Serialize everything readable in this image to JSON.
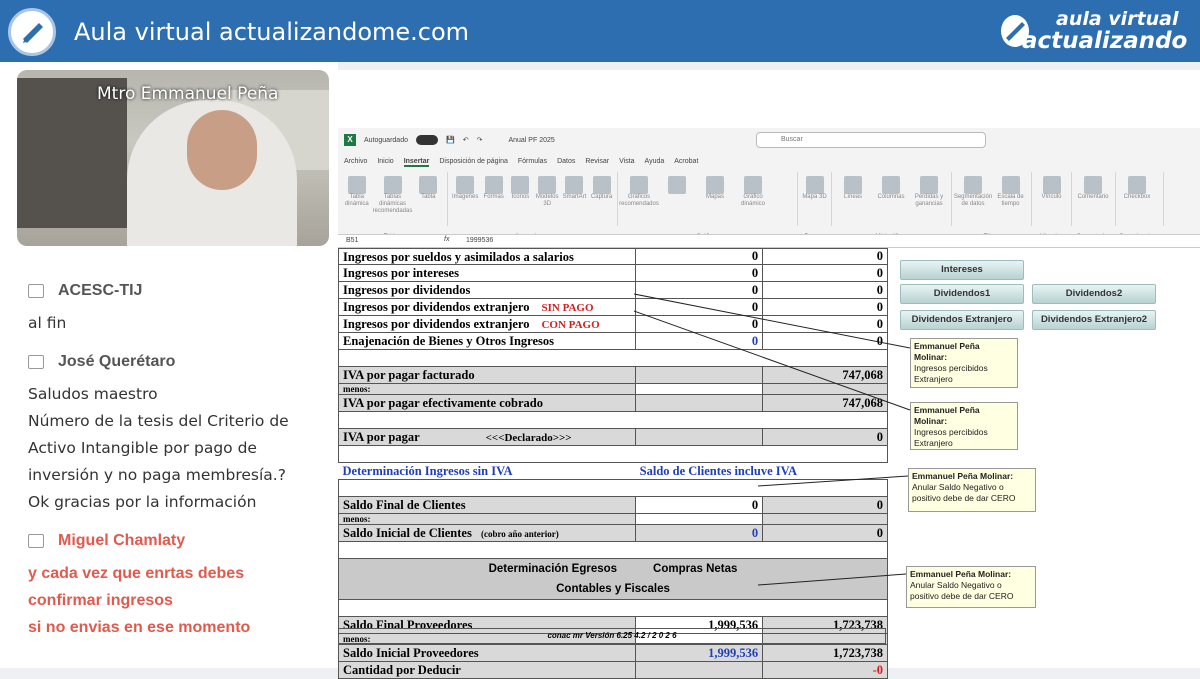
{
  "header": {
    "title": "Aula virtual actualizandome.com",
    "brand_line1": "aula virtual",
    "brand_line2": "actualizando"
  },
  "camera": {
    "presenter_name": "Mtro Emmanuel Peña"
  },
  "chat": [
    {
      "user": "ACESC-TIJ",
      "lines": [
        "al fin"
      ],
      "highlight": false
    },
    {
      "user": "José Querétaro",
      "lines": [
        "Saludos maestro",
        "Número de la tesis del Criterio de",
        "Activo Intangible por pago de",
        "inversión y no paga membresía.?",
        "Ok gracias por la información"
      ],
      "highlight": false
    },
    {
      "user": "Miguel Chamlaty",
      "lines": [
        "y cada vez que enrtas debes",
        "confirmar ingresos",
        "si no envias en ese momento"
      ],
      "highlight": true
    }
  ],
  "excel": {
    "autosave_label": "Autoguardado",
    "file_name": "Anual PF 2025",
    "search_placeholder": "Buscar",
    "menus": [
      "Archivo",
      "Inicio",
      "Insertar",
      "Disposición de página",
      "Fórmulas",
      "Datos",
      "Revisar",
      "Vista",
      "Ayuda",
      "Acrobat"
    ],
    "active_menu": "Insertar",
    "groups": [
      {
        "caption": "Tablas",
        "buttons": [
          "Tabla dinámica",
          "Tablas dinámicas recomendadas",
          "Tabla"
        ]
      },
      {
        "caption": "Ilustraciones",
        "buttons": [
          "Imágenes",
          "Formas",
          "Iconos",
          "Modelos 3D",
          "SmartArt",
          "Captura"
        ]
      },
      {
        "caption": "Gráficos",
        "buttons": [
          "Gráficos recomendados",
          "",
          "Mapas",
          "Gráfico dinámico"
        ]
      },
      {
        "caption": "Paseos",
        "buttons": [
          "Mapa 3D"
        ]
      },
      {
        "caption": "Minigráficos",
        "buttons": [
          "Líneas",
          "Columnas",
          "Pérdidas y ganancias"
        ]
      },
      {
        "caption": "Filtros",
        "buttons": [
          "Segmentación de datos",
          "Escala de tiempo"
        ]
      },
      {
        "caption": "Vínculos",
        "buttons": [
          "Vínculo"
        ]
      },
      {
        "caption": "Comentarios",
        "buttons": [
          "Comentario"
        ]
      },
      {
        "caption": "Controles de ...",
        "buttons": [
          "Checkbox"
        ]
      }
    ],
    "cell_ref": "B51",
    "formula_value": "1999536"
  },
  "sheet": {
    "rows_top": [
      {
        "label": "Ingresos por sueldos y asimilados a salarios",
        "tag": "",
        "v1": "0",
        "v2": "0",
        "v1_blue": false
      },
      {
        "label": "Ingresos por intereses",
        "tag": "",
        "v1": "0",
        "v2": "0",
        "v1_blue": false
      },
      {
        "label": "Ingresos por dividendos",
        "tag": "",
        "v1": "0",
        "v2": "0",
        "v1_blue": false
      },
      {
        "label": "Ingresos por dividendos extranjero",
        "tag": "SIN PAGO",
        "v1": "0",
        "v2": "0",
        "v1_blue": false
      },
      {
        "label": "Ingresos por dividendos extranjero",
        "tag": "CON PAGO",
        "v1": "0",
        "v2": "0",
        "v1_blue": false
      },
      {
        "label": "Enajenación de Bienes y Otros Ingresos",
        "tag": "",
        "v1": "0",
        "v2": "0",
        "v1_blue": true
      }
    ],
    "iva_facturado": {
      "label": "IVA por pagar facturado",
      "v2": "747,068"
    },
    "menos": "menos:",
    "iva_cobrado": {
      "label": "IVA por pagar efectivamente cobrado",
      "v2": "747,068"
    },
    "iva_pagar": {
      "label": "IVA por pagar",
      "mid": "<<<Declarado>>>",
      "v2": "0"
    },
    "det_ingresos": {
      "left": "Determinación Ingresos sin IVA",
      "right": "Saldo de Clientes incluve IVA"
    },
    "saldo_final_clientes": {
      "label": "Saldo Final de Clientes",
      "v1": "0",
      "v2": "0"
    },
    "saldo_inicial_clientes": {
      "label": "Saldo Inicial de Clientes",
      "note": "(cobro año anterior)",
      "v1": "0",
      "v2": "0"
    },
    "egresos_head": {
      "a": "Determinación Egresos",
      "b": "Compras Netas",
      "c": "Contables y Fiscales"
    },
    "saldo_final_prov": {
      "label": "Saldo Final Proveedores",
      "v1": "1,999,536",
      "v2": "1,723,738"
    },
    "saldo_inicial_prov": {
      "label": "Saldo Inicial Proveedores",
      "v1": "1,999,536",
      "v2": "1,723,738"
    },
    "cantidad_deducir": {
      "label": "Cantidad por Deducir",
      "v2": "-0"
    },
    "version": "conac  mr Versión 6.25 4.2  /  2 0 2 6"
  },
  "sheet_buttons": {
    "intereses": "Intereses",
    "div1": "Dividendos1",
    "div2": "Dividendos2",
    "divext": "Dividendos Extranjero",
    "divext2": "Dividendos Extranjero2"
  },
  "notes": [
    {
      "author": "Emmanuel Peña Molinar:",
      "text": "Ingresos percibidos Extranjero"
    },
    {
      "author": "Emmanuel Peña Molinar:",
      "text": "Ingresos percibidos Extranjero"
    },
    {
      "author": "Emmanuel Peña Molinar:",
      "text": "Anular Saldo Negativo o positivo debe de dar CERO"
    },
    {
      "author": "Emmanuel Peña Molinar:",
      "text": "Anular Saldo Negativo o positivo debe de dar CERO"
    }
  ]
}
